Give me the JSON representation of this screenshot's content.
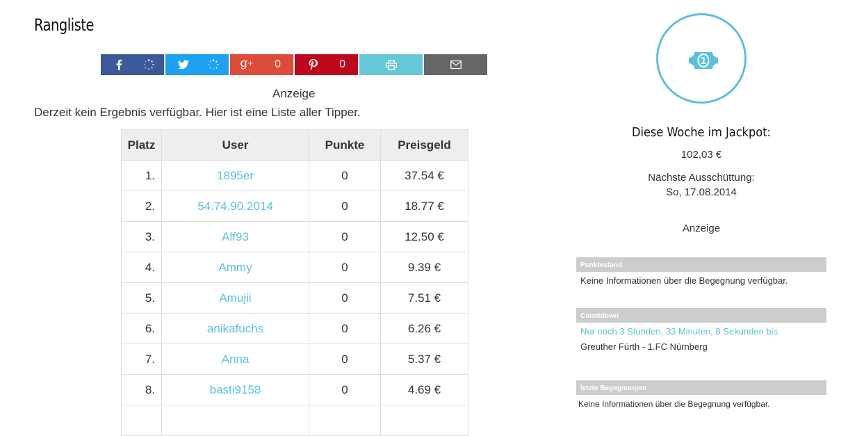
{
  "page_title": "Rangliste",
  "share": {
    "googleplus_count": "0",
    "pinterest_count": "0"
  },
  "main": {
    "anzeige": "Anzeige",
    "intro": "Derzeit kein Ergebnis verfügbar. Hier ist eine Liste aller Tipper."
  },
  "table": {
    "headers": [
      "Platz",
      "User",
      "Punkte",
      "Preisgeld"
    ],
    "rows": [
      {
        "platz": "1.",
        "user": "1895er",
        "punkte": "0",
        "preisgeld": "37.54 €"
      },
      {
        "platz": "2.",
        "user": "54.74.90.2014",
        "punkte": "0",
        "preisgeld": "18.77 €"
      },
      {
        "platz": "3.",
        "user": "Alf93",
        "punkte": "0",
        "preisgeld": "12.50 €"
      },
      {
        "platz": "4.",
        "user": "Ammy",
        "punkte": "0",
        "preisgeld": "9.39 €"
      },
      {
        "platz": "5.",
        "user": "Amujii",
        "punkte": "0",
        "preisgeld": "7.51 €"
      },
      {
        "platz": "6.",
        "user": "anikafuchs",
        "punkte": "0",
        "preisgeld": "6.26 €"
      },
      {
        "platz": "7.",
        "user": "Anna",
        "punkte": "0",
        "preisgeld": "5.37 €"
      },
      {
        "platz": "8.",
        "user": "basti9158",
        "punkte": "0",
        "preisgeld": "4.69 €"
      }
    ]
  },
  "sidebar": {
    "jackpot_title": "Diese Woche im Jackpot:",
    "jackpot_amount": "102,03 €",
    "next_payout_label": "Nächste Ausschüttung:",
    "next_payout_date": "So, 17.08.2014",
    "anzeige": "Anzeige",
    "widgets": [
      {
        "title": "Punktestand",
        "lines": [
          "Keine Informationen über die Begegnung verfügbar."
        ]
      },
      {
        "title": "Countdown",
        "lines": [
          "Nur noch 3 Stunden, 33 Minuten, 8 Sekunden bis",
          "Greuther Fürth - 1.FC Nürnberg"
        ]
      },
      {
        "title": "letzte Begegnungen",
        "lines": [
          "Keine Informationen über die Begegnung verfügbar."
        ]
      }
    ]
  },
  "colors": {
    "accent": "#5bc0de",
    "facebook": "#3b5998",
    "twitter": "#1da1f2",
    "googleplus": "#dd4b39",
    "pinterest": "#bd081c",
    "print": "#64c8d6",
    "mail": "#666666",
    "widget_header": "#cccccc"
  },
  "icons": [
    "facebook-icon",
    "twitter-icon",
    "googleplus-icon",
    "pinterest-icon",
    "print-icon",
    "mail-icon",
    "loading-spinner-icon",
    "money-icon"
  ]
}
